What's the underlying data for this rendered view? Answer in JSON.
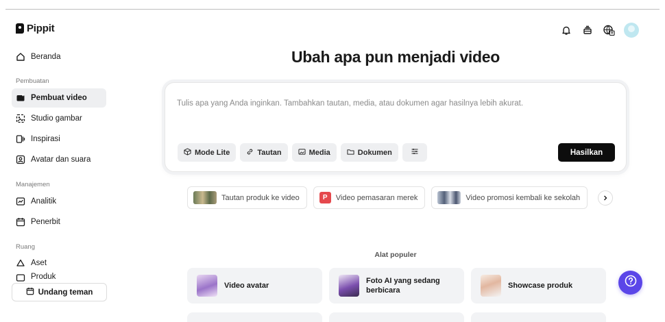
{
  "app": {
    "logo_text": "Pippit"
  },
  "sidebar": {
    "home": {
      "label": "Beranda",
      "icon": "home-icon"
    },
    "sections": [
      {
        "label": "Pembuatan"
      },
      {
        "label": "Manajemen"
      },
      {
        "label": "Ruang"
      }
    ],
    "items": [
      {
        "label": "Pembuat video",
        "icon": "video-create-icon",
        "active": true
      },
      {
        "label": "Studio gambar",
        "icon": "image-studio-icon"
      },
      {
        "label": "Inspirasi",
        "icon": "inspiration-icon"
      },
      {
        "label": "Avatar dan suara",
        "icon": "avatar-voice-icon"
      },
      {
        "label": "Analitik",
        "icon": "analytics-icon"
      },
      {
        "label": "Penerbit",
        "icon": "calendar-icon"
      },
      {
        "label": "Aset",
        "icon": "cloud-icon"
      },
      {
        "label": "Produk",
        "icon": "product-icon"
      }
    ],
    "invite_label": "Undang teman"
  },
  "header": {
    "icons": [
      "bell-icon",
      "stack-icon",
      "globe-language-icon",
      "user-avatar"
    ]
  },
  "main": {
    "title": "Ubah apa pun menjadi video",
    "prompt": {
      "placeholder": "Tulis apa yang Anda inginkan. Tambahkan tautan, media, atau dokumen agar hasilnya lebih akurat.",
      "tools": [
        {
          "label": "Mode Lite",
          "icon": "cube-icon"
        },
        {
          "label": "Tautan",
          "icon": "link-icon"
        },
        {
          "label": "Media",
          "icon": "image-icon"
        },
        {
          "label": "Dokumen",
          "icon": "folder-icon"
        },
        {
          "label": "",
          "icon": "settings-sliders-icon"
        }
      ],
      "generate_label": "Hasilkan"
    },
    "suggestions": [
      {
        "label": "Tautan produk ke video"
      },
      {
        "label": "Video pemasaran merek",
        "badge": "P"
      },
      {
        "label": "Video promosi kembali ke sekolah"
      }
    ],
    "popular": {
      "label": "Alat populer",
      "tools": [
        {
          "label": "Video avatar"
        },
        {
          "label_line1": "Foto AI yang sedang",
          "label_line2": "berbicara"
        },
        {
          "label": "Showcase produk"
        }
      ]
    }
  },
  "colors": {
    "accent": "#5b46e8",
    "primary_button": "#0d0d0d",
    "badge_red": "#e5484d"
  }
}
